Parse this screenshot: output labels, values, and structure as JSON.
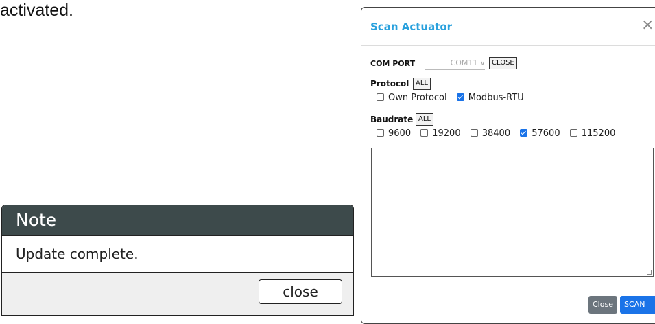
{
  "background": {
    "text": "activated."
  },
  "note_dialog": {
    "title": "Note",
    "message": "Update complete.",
    "close_label": "close",
    "header_color": "#3d4a4b"
  },
  "scan_modal": {
    "title": "Scan Actuator",
    "close_x": "×",
    "com_port": {
      "label": "COM PORT",
      "selected": "COM11",
      "close_button": "CLOSE"
    },
    "protocol": {
      "label": "Protocol",
      "all_button": "ALL",
      "options": [
        {
          "label": "Own Protocol",
          "checked": false
        },
        {
          "label": "Modbus-RTU",
          "checked": true
        }
      ]
    },
    "baudrate": {
      "label": "Baudrate",
      "all_button": "ALL",
      "options": [
        {
          "label": "9600",
          "checked": false
        },
        {
          "label": "19200",
          "checked": false
        },
        {
          "label": "38400",
          "checked": false
        },
        {
          "label": "57600",
          "checked": true
        },
        {
          "label": "115200",
          "checked": false
        }
      ]
    },
    "log_text": "",
    "footer": {
      "close_label": "Close",
      "scan_label": "SCAN"
    },
    "accent_color": "#2aa1dd"
  }
}
